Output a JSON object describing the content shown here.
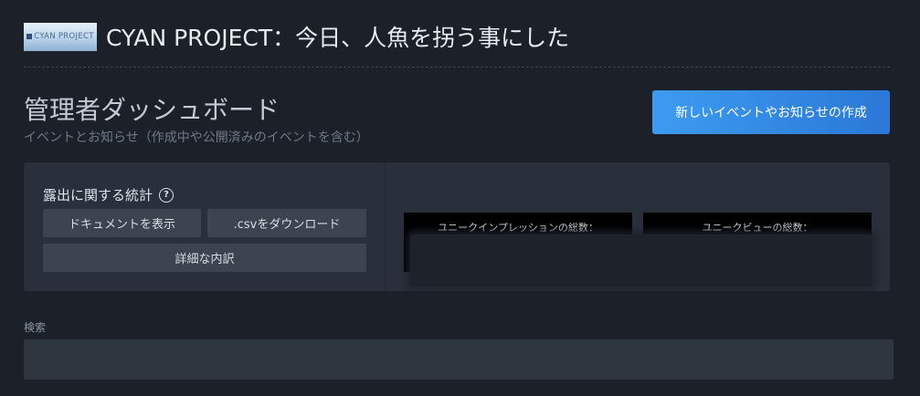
{
  "header": {
    "logo_text": "CYAN PROJECT",
    "title": "CYAN PROJECT：今日、人魚を拐う事にした"
  },
  "dashboard": {
    "title": "管理者ダッシュボード",
    "subtitle": "イベントとお知らせ（作成中や公開済みのイベントを含む）",
    "create_button": "新しいイベントやお知らせの作成"
  },
  "stats": {
    "label": "露出に関する統計",
    "help_icon": "?",
    "docs_button": "ドキュメントを表示",
    "csv_button": ".csvをダウンロード",
    "breakdown_button": "詳細な内訳",
    "impressions_label": "ユニークインプレッションの総数：",
    "views_label": "ユニークビューの総数："
  },
  "search": {
    "label": "検索",
    "placeholder": ""
  }
}
